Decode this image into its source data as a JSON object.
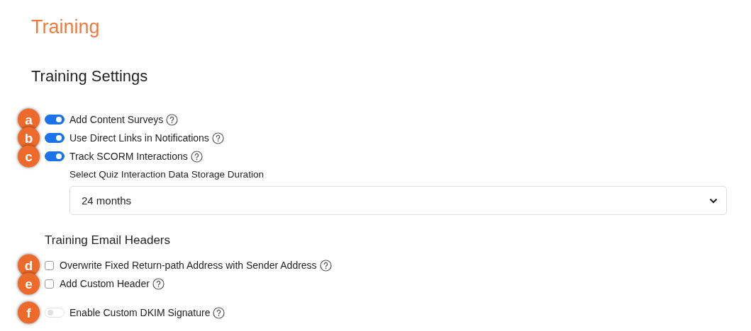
{
  "page_title": "Training",
  "section_title": "Training Settings",
  "settings": [
    {
      "marker": "a",
      "kind": "toggle",
      "label": "Add Content Surveys",
      "on": true,
      "disabled": false
    },
    {
      "marker": "b",
      "kind": "toggle",
      "label": "Use Direct Links in Notifications",
      "on": true,
      "disabled": false
    },
    {
      "marker": "c",
      "kind": "toggle",
      "label": "Track SCORM Interactions",
      "on": true,
      "disabled": false
    }
  ],
  "duration": {
    "label": "Select Quiz Interaction Data Storage Duration",
    "value": "24 months"
  },
  "email_headers": {
    "title": "Training Email Headers",
    "settings": [
      {
        "marker": "d",
        "kind": "checkbox",
        "label": "Overwrite Fixed Return-path Address with Sender Address",
        "checked": false
      },
      {
        "marker": "e",
        "kind": "checkbox",
        "label": "Add Custom Header",
        "checked": false
      },
      {
        "marker": "f",
        "kind": "toggle",
        "label": "Enable Custom DKIM Signature",
        "on": false,
        "disabled": true
      }
    ]
  }
}
